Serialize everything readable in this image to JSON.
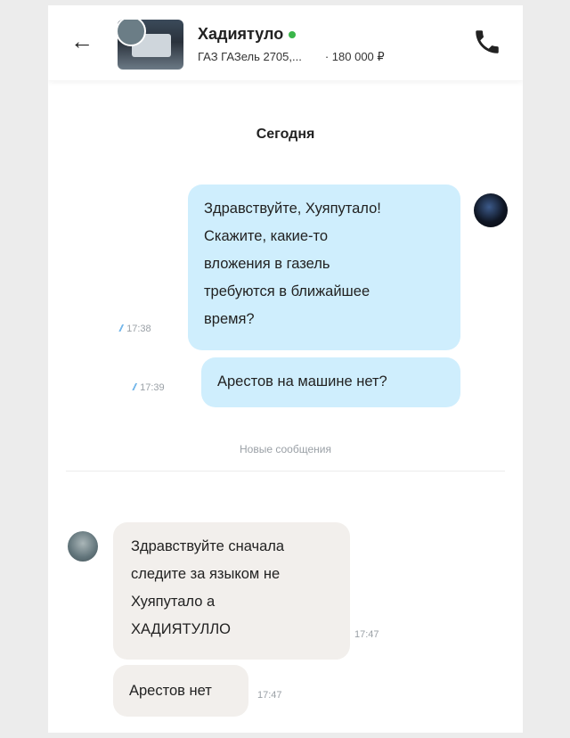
{
  "header": {
    "back_icon": "arrow-left-icon",
    "name": "Хадиятуло",
    "online_color": "#3ab54a",
    "listing_title": "ГАЗ ГАЗель 2705,...",
    "price": "· 180 000 ₽",
    "call_icon": "phone-icon"
  },
  "date_separator": "Сегодня",
  "messages_out": [
    {
      "lines": [
        "Здравствуйте, Хуяпутало!",
        "Скажите, какие-то",
        "вложения в газель",
        "требуются в ближайшее",
        "время?"
      ],
      "time": "17:38",
      "status": "//"
    },
    {
      "lines": [
        "Арестов на машине нет?"
      ],
      "time": "17:39",
      "status": "//"
    }
  ],
  "new_messages_label": "Новые сообщения",
  "messages_in": [
    {
      "lines": [
        "Здравствуйте сначала",
        "следите за языком не",
        "Хуяпутало а",
        "ХАДИЯТУЛЛО"
      ],
      "time": "17:47"
    },
    {
      "lines": [
        "Арестов нет"
      ],
      "time": "17:47"
    }
  ],
  "colors": {
    "outgoing_bubble": "#cfeefd",
    "incoming_bubble": "#f2efec",
    "read_tick": "#5aa9e6"
  }
}
